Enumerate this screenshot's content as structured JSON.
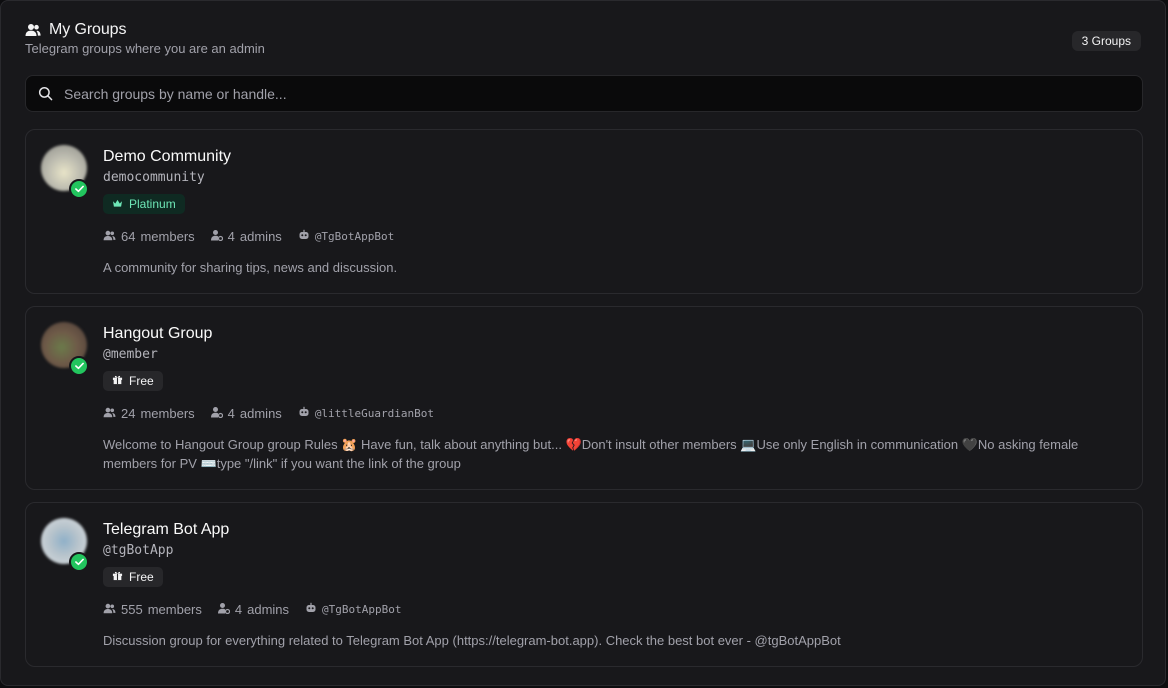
{
  "header": {
    "title": "My Groups",
    "subtitle": "Telegram groups where you are an admin",
    "count_label": "3 Groups"
  },
  "search": {
    "placeholder": "Search groups by name or handle...",
    "value": ""
  },
  "groups": [
    {
      "name": "Demo Community",
      "handle": "democommunity",
      "tier": "Platinum",
      "members": "64",
      "members_label": "members",
      "admins": "4",
      "admins_label": "admins",
      "bot": "@TgBotAppBot",
      "description": "A community for sharing tips, news and discussion.",
      "verified": true
    },
    {
      "name": "Hangout Group",
      "handle": "@member",
      "tier": "Free",
      "members": "24",
      "members_label": "members",
      "admins": "4",
      "admins_label": "admins",
      "bot": "@littleGuardianBot",
      "description": "Welcome to Hangout Group group Rules 🐹 Have fun, talk about anything but... 💔Don't insult other members 💻Use only English in communication 🖤No asking female members for PV ⌨️type \"/link\" if you want the link of the group",
      "verified": true
    },
    {
      "name": "Telegram Bot App",
      "handle": "@tgBotApp",
      "tier": "Free",
      "members": "555",
      "members_label": "members",
      "admins": "4",
      "admins_label": "admins",
      "bot": "@TgBotAppBot",
      "description": "Discussion group for everything related to Telegram Bot App (https://telegram-bot.app). Check the best bot ever - @tgBotAppBot",
      "verified": true
    }
  ],
  "icons": {
    "header": "users-icon",
    "search": "search-icon",
    "verified": "check-icon",
    "platinum": "crown-icon",
    "free": "gift-icon",
    "members": "users-icon",
    "admins": "user-cog-icon",
    "bot": "bot-icon"
  },
  "colors": {
    "background": "#18181b",
    "accent_green": "#22c55e",
    "platinum_text": "#6ee7b7",
    "muted_text": "#a1a1aa"
  }
}
